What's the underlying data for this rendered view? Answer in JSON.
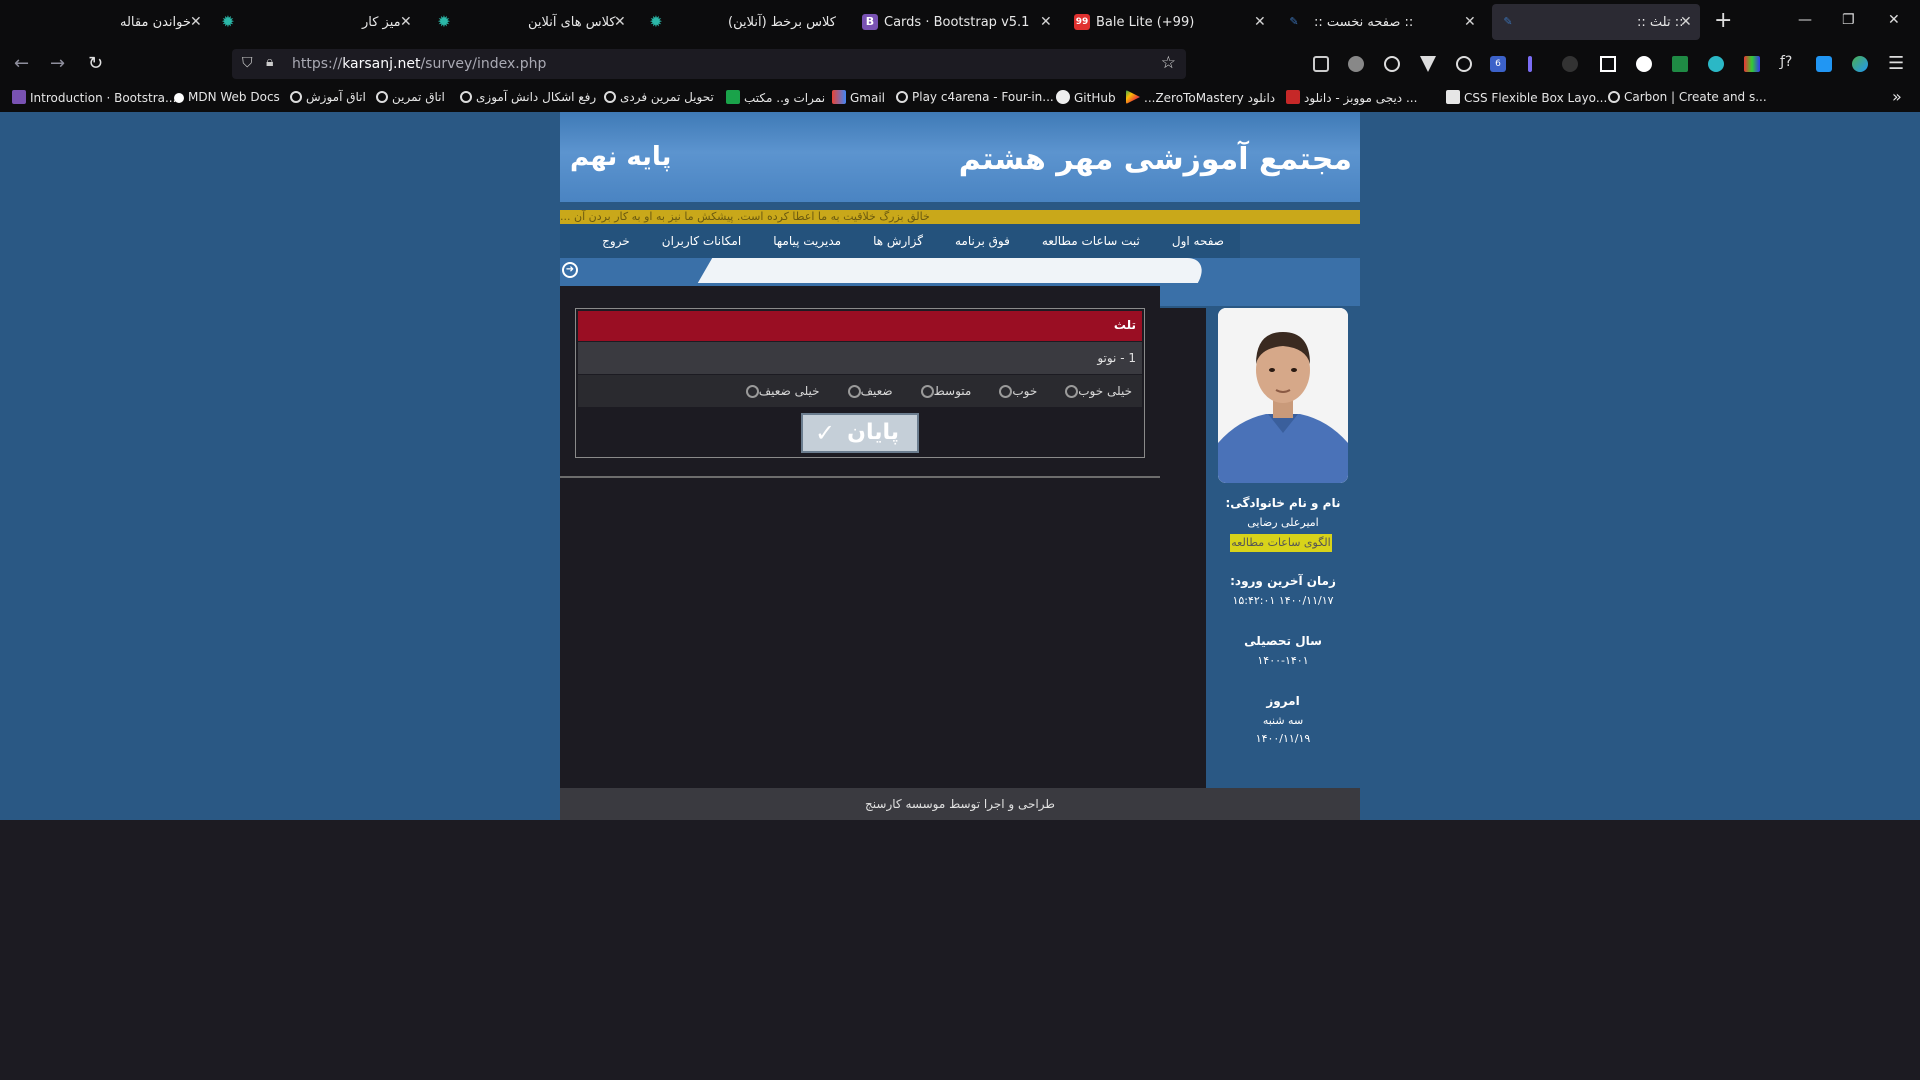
{
  "tabs": [
    {
      "title": "خواندن مقاله",
      "active": false
    },
    {
      "title": "میز کار",
      "active": false
    },
    {
      "title": "کلاس های آنلاین",
      "active": false
    },
    {
      "title": "کلاس برخط (آنلاین)",
      "active": false
    },
    {
      "title": "Cards · Bootstrap v5.1",
      "active": false
    },
    {
      "title": "Bale Lite (+99)",
      "active": false
    },
    {
      "title": ":: صفحه نخست ::",
      "active": false
    },
    {
      "title": ":: تلث ::",
      "active": true
    }
  ],
  "badges": {
    "bale": "99",
    "ext_count": "6"
  },
  "url": {
    "prefix": "https://",
    "domain": "karsanj.net",
    "path": "/survey/index.php"
  },
  "bookmarks": [
    "Introduction · Bootstra...",
    "MDN Web Docs",
    "اتاق آموزش",
    "اتاق تمرین",
    "رفع اشکال دانش آموزی",
    "تحویل تمرین فردی",
    "نمرات و.. مکتب",
    "Gmail",
    "Play c4arena - Four-in...",
    "GitHub",
    "...ZeroToMastery دانلود",
    "دیجی مووبز - دانلود ...",
    "CSS Flexible Box Layo...",
    "Carbon | Create and s..."
  ],
  "site": {
    "title": "مجتمع آموزشی مهر هشتم",
    "grade": "پایه نهم",
    "marquee": "خالق بزرگ خلاقیت به ما اعطا کرده است. پیشکش ما نیز به او به کار بردن آن ..."
  },
  "menu": [
    "صفحه اول",
    "ثبت ساعات مطالعه",
    "فوق برنامه",
    "گزارش ها",
    "مدیریت پیامها",
    "امکانات کاربران",
    "خروج"
  ],
  "survey": {
    "header": "تلث",
    "question": "1 - نوتو",
    "options": [
      "خیلی خوب",
      "خوب",
      "متوسط",
      "ضعیف",
      "خیلی ضعیف"
    ],
    "finish_label": "پایان"
  },
  "sidebar": {
    "name_label": "نام و نام خانوادگی:",
    "name": "امیرعلی رضایی",
    "pattern_link": "الگوی ساعات مطالعه",
    "last_login_label": "زمان آخرین ورود:",
    "last_login": "۱۴۰۰/۱۱/۱۷ ۱۵:۴۲:۰۱",
    "year_label": "سال تحصیلی",
    "year": "۱۴۰۰-۱۴۰۱",
    "today_label": "امروز",
    "weekday": "سه شنبه",
    "today_date": "۱۴۰۰/۱۱/۱۹"
  },
  "footer": "طراحی و اجرا توسط موسسه کارسنج",
  "colors": {
    "header_red": "#9a0e23",
    "page_blue": "#2a5884",
    "highlight_yellow": "#d8d31a"
  }
}
